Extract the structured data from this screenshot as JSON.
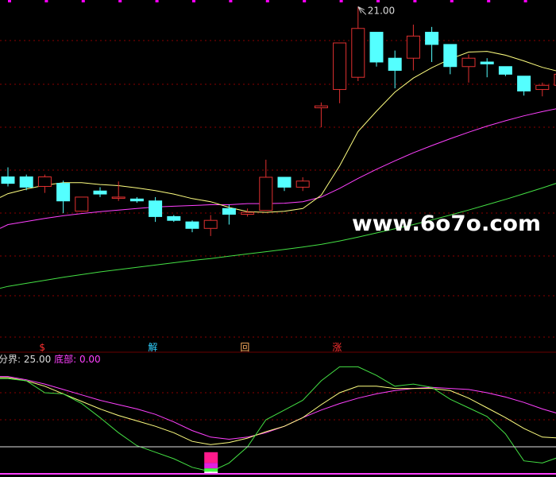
{
  "watermark": "www.6o7o.com",
  "price_chart": {
    "type": "candlestick",
    "high_label": "21.00",
    "candle_width": 16,
    "candles": [
      {
        "o": 16.49,
        "h": 16.74,
        "l": 16.24,
        "c": 16.32
      },
      {
        "o": 16.49,
        "h": 16.55,
        "l": 16.14,
        "c": 16.22
      },
      {
        "o": 16.24,
        "h": 16.55,
        "l": 16.07,
        "c": 16.49
      },
      {
        "o": 16.32,
        "h": 16.39,
        "l": 15.54,
        "c": 15.86
      },
      {
        "o": 15.59,
        "h": 15.96,
        "l": 15.59,
        "c": 15.96
      },
      {
        "o": 16.12,
        "h": 16.22,
        "l": 15.96,
        "c": 16.04
      },
      {
        "o": 15.94,
        "h": 16.37,
        "l": 15.86,
        "c": 15.96
      },
      {
        "o": 15.91,
        "h": 15.96,
        "l": 15.81,
        "c": 15.86
      },
      {
        "o": 15.86,
        "h": 15.96,
        "l": 15.31,
        "c": 15.45
      },
      {
        "o": 15.45,
        "h": 15.49,
        "l": 15.31,
        "c": 15.35
      },
      {
        "o": 15.31,
        "h": 15.35,
        "l": 15.04,
        "c": 15.14
      },
      {
        "o": 15.14,
        "h": 15.49,
        "l": 14.94,
        "c": 15.35
      },
      {
        "o": 15.66,
        "h": 15.76,
        "l": 15.24,
        "c": 15.51
      },
      {
        "o": 15.51,
        "h": 15.66,
        "l": 15.45,
        "c": 15.56
      },
      {
        "o": 15.61,
        "h": 16.94,
        "l": 15.61,
        "c": 16.48
      },
      {
        "o": 16.48,
        "h": 16.48,
        "l": 16.12,
        "c": 16.22
      },
      {
        "o": 16.22,
        "h": 16.48,
        "l": 16.12,
        "c": 16.38
      },
      {
        "o": 18.3,
        "h": 18.44,
        "l": 17.79,
        "c": 18.35
      },
      {
        "o": 18.78,
        "h": 20.0,
        "l": 18.42,
        "c": 20.0
      },
      {
        "o": 19.1,
        "h": 20.95,
        "l": 19.0,
        "c": 20.38
      },
      {
        "o": 20.28,
        "h": 20.28,
        "l": 19.38,
        "c": 19.5
      },
      {
        "o": 19.6,
        "h": 19.8,
        "l": 18.81,
        "c": 19.28
      },
      {
        "o": 19.6,
        "h": 20.48,
        "l": 19.28,
        "c": 20.18
      },
      {
        "o": 20.28,
        "h": 20.42,
        "l": 19.5,
        "c": 19.96
      },
      {
        "o": 19.96,
        "h": 19.96,
        "l": 19.18,
        "c": 19.38
      },
      {
        "o": 19.38,
        "h": 19.7,
        "l": 18.96,
        "c": 19.6
      },
      {
        "o": 19.5,
        "h": 19.6,
        "l": 19.1,
        "c": 19.45
      },
      {
        "o": 19.38,
        "h": 19.38,
        "l": 19.13,
        "c": 19.18
      },
      {
        "o": 19.13,
        "h": 19.13,
        "l": 18.62,
        "c": 18.74
      },
      {
        "o": 18.78,
        "h": 18.96,
        "l": 18.6,
        "c": 18.89
      },
      {
        "o": 18.89,
        "h": 19.38,
        "l": 18.68,
        "c": 19.18
      }
    ],
    "ma_short": [
      16.05,
      16.17,
      16.27,
      16.34,
      16.34,
      16.29,
      16.26,
      16.2,
      16.13,
      16.04,
      15.92,
      15.84,
      15.69,
      15.58,
      15.56,
      15.59,
      15.66,
      16.01,
      16.78,
      17.68,
      18.21,
      18.71,
      19.08,
      19.35,
      19.58,
      19.76,
      19.78,
      19.68,
      19.53,
      19.36,
      19.24
    ],
    "ma_mid": [
      15.24,
      15.32,
      15.4,
      15.47,
      15.53,
      15.58,
      15.62,
      15.66,
      15.7,
      15.72,
      15.74,
      15.76,
      15.76,
      15.79,
      15.79,
      15.8,
      15.84,
      15.96,
      16.19,
      16.45,
      16.69,
      16.91,
      17.12,
      17.31,
      17.49,
      17.66,
      17.82,
      17.96,
      18.09,
      18.2,
      18.3
    ],
    "ma_long": [
      13.62,
      13.7,
      13.78,
      13.86,
      13.93,
      14.0,
      14.06,
      14.12,
      14.18,
      14.24,
      14.3,
      14.35,
      14.41,
      14.47,
      14.53,
      14.59,
      14.65,
      14.72,
      14.81,
      14.91,
      15.02,
      15.13,
      15.24,
      15.36,
      15.49,
      15.62,
      15.76,
      15.9,
      16.05,
      16.2,
      16.36
    ],
    "signals": [
      {
        "index": 1,
        "glyph": "$",
        "color": "#ff3030"
      },
      {
        "index": 7,
        "glyph": "解",
        "color": "#30d0ff"
      },
      {
        "index": 12,
        "glyph": "回",
        "color": "#ffb060"
      },
      {
        "index": 17,
        "glyph": "涨",
        "color": "#ff3030"
      }
    ]
  },
  "indicator_chart": {
    "type": "line",
    "label_divider": "分界",
    "divider_value": "25.00",
    "label_bottom": "底部",
    "bottom_value": "0.00",
    "ylim": [
      0,
      100
    ],
    "divider": 25,
    "green": [
      88,
      86,
      75,
      74,
      65,
      52,
      38,
      26,
      20,
      14,
      6,
      2,
      10,
      25,
      50,
      59,
      68,
      86,
      99,
      99,
      91,
      81,
      83,
      80,
      69,
      61,
      53,
      37,
      12,
      10,
      16
    ],
    "yellow": [
      89,
      86,
      81,
      74,
      67,
      60,
      54,
      49,
      44,
      38,
      30,
      27,
      29,
      33,
      39,
      44,
      52,
      64,
      75,
      81,
      81,
      79,
      79,
      79,
      77,
      70,
      61,
      52,
      42,
      34,
      33
    ],
    "magenta": [
      90,
      87,
      83,
      78,
      73,
      68,
      64,
      60,
      55,
      48,
      40,
      34,
      32,
      34,
      38,
      44,
      52,
      59,
      65,
      70,
      74,
      77,
      79,
      80,
      79,
      78,
      75,
      71,
      66,
      60,
      55
    ],
    "bar_index": 11,
    "bar_segments": [
      {
        "value": 10,
        "color": "#ff1a8c"
      },
      {
        "value": 5,
        "color": "#e020e0"
      },
      {
        "value": 3,
        "color": "#44ff44"
      },
      {
        "value": 2,
        "color": "#ffffff"
      }
    ]
  },
  "colors": {
    "up": "#e03030",
    "down": "#54ffff",
    "ma_short": "#ffff80",
    "ma_mid": "#ff40ff",
    "ma_long": "#44e044",
    "grid": "#8a0000",
    "text": "#dcdcdc",
    "text_pink": "#ff40ff",
    "top_marks": "#ff00ff"
  }
}
